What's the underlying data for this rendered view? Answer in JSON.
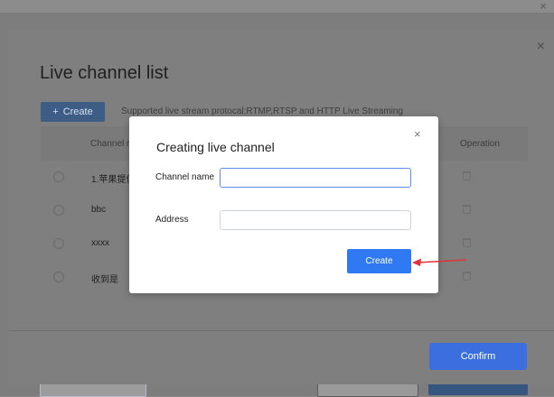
{
  "outer_close_icon": "×",
  "modal": {
    "close_icon": "×",
    "title": "Live channel list",
    "create_button_label": "Create",
    "create_button_icon": "+",
    "protocol_note": "Supported live stream protocal:RTMP,RTSP and HTTP Live Streaming",
    "table": {
      "col_channel": "Channel r",
      "col_operation": "Operation",
      "rows": [
        {
          "name": "1.苹果提供",
          "trash_icon": "trash-icon"
        },
        {
          "name": "bbc",
          "trash_icon": "trash-icon"
        },
        {
          "name": "xxxx",
          "trash_icon": "trash-icon"
        },
        {
          "name": "收到是",
          "trash_icon": "trash-icon"
        }
      ]
    },
    "confirm_label": "Confirm"
  },
  "dialog": {
    "title": "Creating live channel",
    "close_icon": "×",
    "channel_name_label": "Channel name",
    "channel_name_value": "",
    "address_label": "Address",
    "address_value": "",
    "create_label": "Create"
  },
  "colors": {
    "primary": "#2f7af2",
    "annotation_arrow": "#e0323a"
  }
}
